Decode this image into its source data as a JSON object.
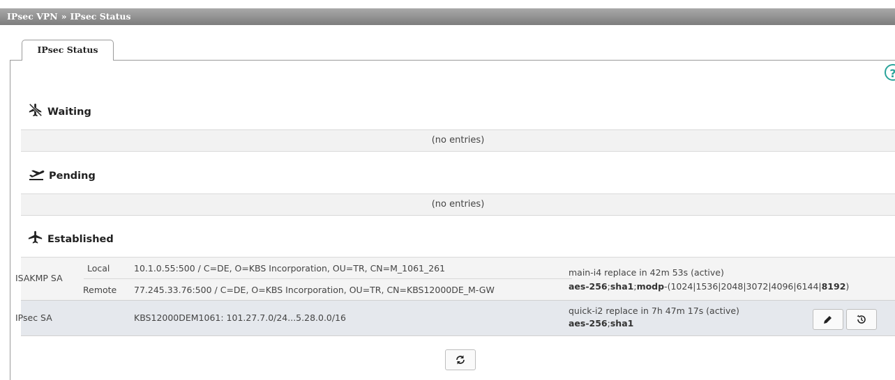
{
  "breadcrumb": {
    "part1": "IPsec VPN",
    "sep": "»",
    "part2": "IPsec Status"
  },
  "tab": {
    "label": "IPsec Status"
  },
  "help": {
    "glyph": "?"
  },
  "sections": {
    "waiting": {
      "title": "Waiting",
      "empty": "(no entries)",
      "icon": "plane-slash-icon"
    },
    "pending": {
      "title": "Pending",
      "empty": "(no entries)",
      "icon": "plane-departure-icon"
    },
    "established": {
      "title": "Established",
      "icon": "plane-icon"
    }
  },
  "isakmp": {
    "label": "ISAKMP SA",
    "local_label": "Local",
    "local_value": "10.1.0.55:500 / C=DE, O=KBS Incorporation, OU=TR, CN=M_1061_261",
    "remote_label": "Remote",
    "remote_value": "77.245.33.76:500 / C=DE, O=KBS Incorporation, OU=TR, CN=KBS12000DE_M-GW",
    "status": "main-i4 replace in 42m 53s (active)",
    "algo": {
      "enc": "aes-256",
      "sep1": ";",
      "hash": "sha1",
      "sep2": ";",
      "dh": "modp",
      "dh_list": "-(1024|1536|2048|3072|4096|6144|",
      "dh_last": "8192",
      "close": ")"
    }
  },
  "ipsec": {
    "label": "IPsec SA",
    "value": "KBS12000DEM1061: 101.27.7.0/24...5.28.0.0/16",
    "status": "quick-i2 replace in 7h 47m 17s (active)",
    "algo": {
      "enc": "aes-256",
      "sep": ";",
      "hash": "sha1"
    }
  },
  "actions": {
    "edit_icon": "pencil-icon",
    "history_icon": "history-icon",
    "refresh_icon": "refresh-icon"
  },
  "colors": {
    "titlebar": "#8c8c8c",
    "help": "#2aa39a",
    "row_highlight": "#e5e8ed"
  }
}
